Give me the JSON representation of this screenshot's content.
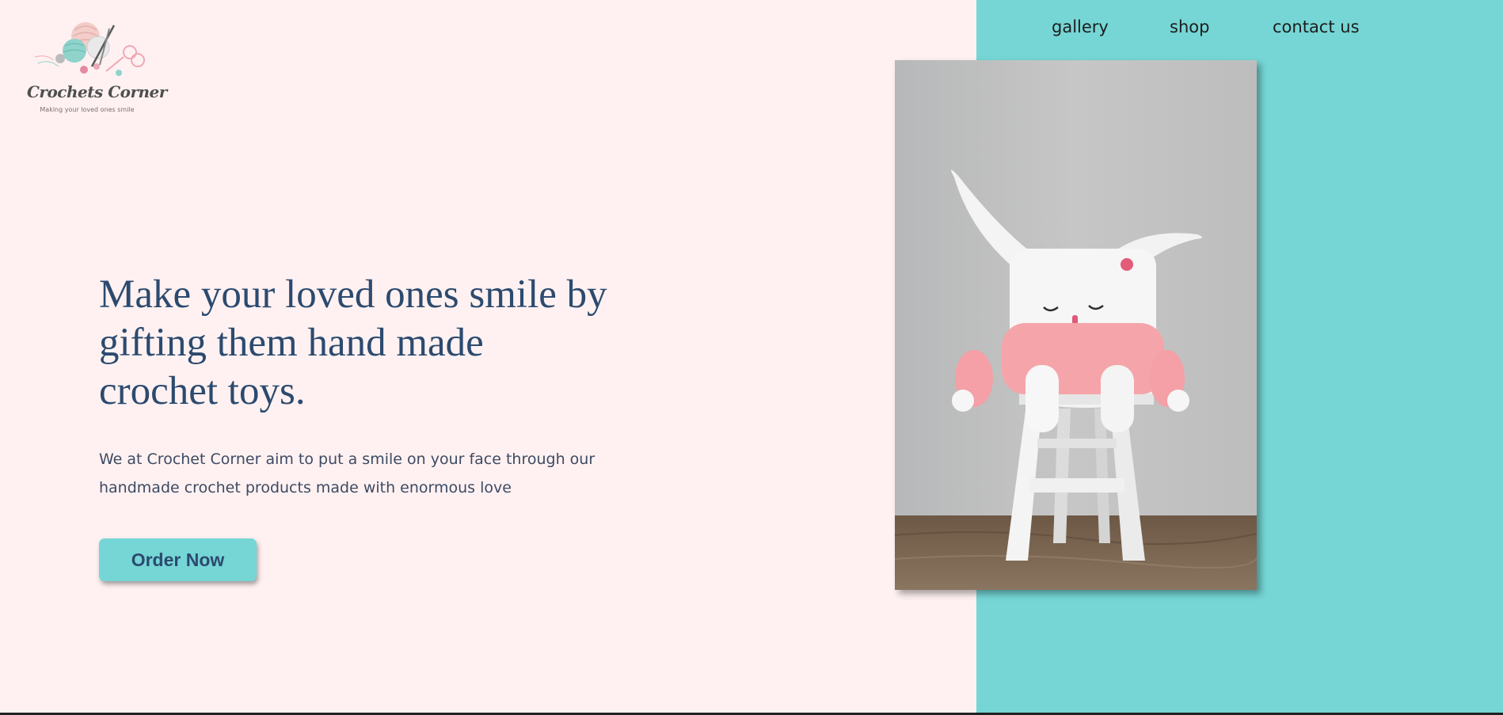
{
  "brand": {
    "name": "Crochets Corner",
    "tagline": "Making your loved ones smile",
    "logo_icon": "yarn-balls-scissors-icon"
  },
  "nav": {
    "items": [
      {
        "label": "gallery"
      },
      {
        "label": "shop"
      },
      {
        "label": "contact us"
      }
    ]
  },
  "hero": {
    "headline_lines": [
      "Make your loved ones smile by",
      "gifting them hand made",
      "crochet toys."
    ],
    "description_lines": [
      "We at Crochet Corner aim to put a smile on your face through our",
      "handmade crochet products made with enormous love"
    ],
    "cta_label": "Order Now"
  },
  "colors": {
    "background": "#fff1f1",
    "accent": "#75d6d5",
    "heading": "#2c4a6f"
  },
  "image": {
    "subject": "crochet-bunny-on-stool-photo"
  }
}
